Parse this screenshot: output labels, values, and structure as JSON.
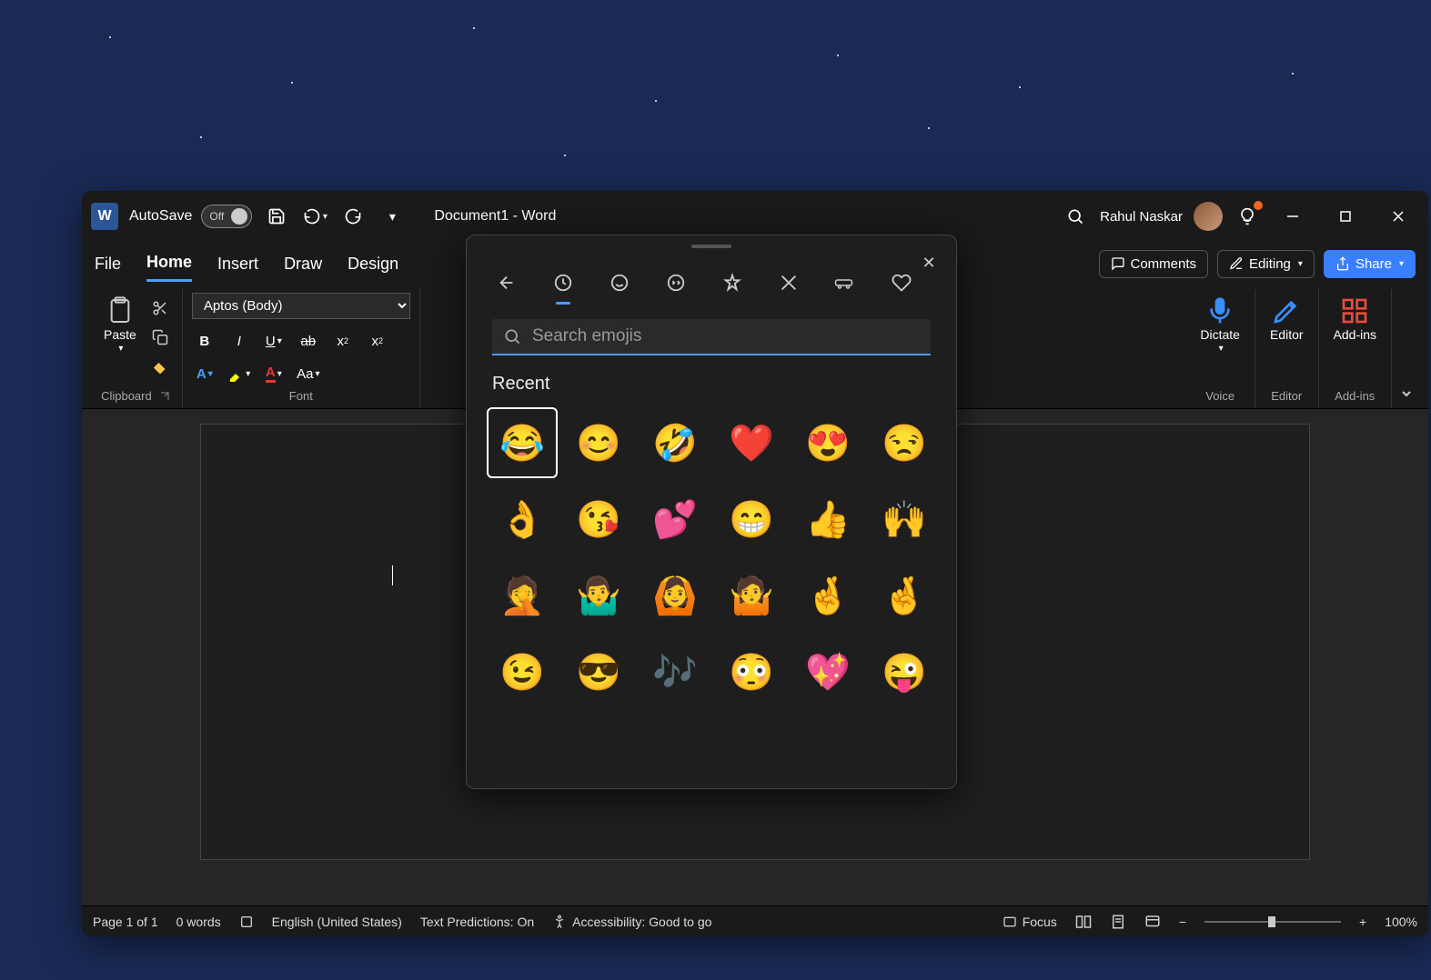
{
  "titlebar": {
    "autosave_label": "AutoSave",
    "autosave_state": "Off",
    "title": "Document1  -  Word",
    "user_name": "Rahul Naskar"
  },
  "tabs": {
    "items": [
      "File",
      "Home",
      "Insert",
      "Draw",
      "Design"
    ],
    "active": "Home",
    "comments": "Comments",
    "editing": "Editing",
    "share": "Share"
  },
  "ribbon": {
    "clipboard": {
      "paste": "Paste",
      "label": "Clipboard"
    },
    "font": {
      "name": "Aptos (Body)",
      "label": "Font"
    },
    "voice": {
      "dictate": "Dictate",
      "label": "Voice"
    },
    "editor": {
      "editor": "Editor",
      "label": "Editor"
    },
    "addins": {
      "addins": "Add-ins",
      "label": "Add-ins"
    }
  },
  "statusbar": {
    "page": "Page 1 of 1",
    "words": "0 words",
    "lang": "English (United States)",
    "predictions": "Text Predictions: On",
    "accessibility": "Accessibility: Good to go",
    "focus": "Focus",
    "zoom": "100%"
  },
  "picker": {
    "search_placeholder": "Search emojis",
    "section": "Recent",
    "emojis": [
      "😂",
      "😊",
      "🤣",
      "❤️",
      "😍",
      "😒",
      "👌",
      "😘",
      "💕",
      "😁",
      "👍",
      "🙌",
      "🤦",
      "🤷‍♂️",
      "🙆",
      "🤷",
      "🤞",
      "🤞",
      "😉",
      "😎",
      "🎶",
      "😳",
      "💖",
      "😜"
    ]
  }
}
